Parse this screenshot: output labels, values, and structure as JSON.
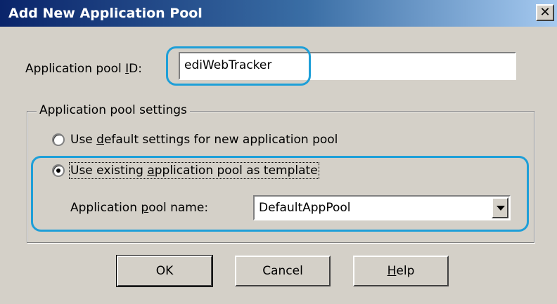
{
  "window": {
    "title": "Add New Application Pool",
    "close_glyph": "✕"
  },
  "pool_id": {
    "label_pre": "Application pool ",
    "label_key": "I",
    "label_post": "D:",
    "value": "ediWebTracker"
  },
  "settings": {
    "legend": "Application pool settings",
    "radio_default": {
      "label_pre": "Use ",
      "label_key": "d",
      "label_post": "efault settings for new application pool",
      "selected": false
    },
    "radio_existing": {
      "label_pre": "Use existing ",
      "label_key": "a",
      "label_post": "pplication pool as template",
      "selected": true
    },
    "pool_name": {
      "label_pre": "Application ",
      "label_key": "p",
      "label_post": "ool name:",
      "selected_value": "DefaultAppPool"
    }
  },
  "buttons": {
    "ok": "OK",
    "cancel": "Cancel",
    "help_key": "H",
    "help_post": "elp"
  },
  "colors": {
    "highlight": "#1e9fd8",
    "title_bar": "#0a246a",
    "dialog_bg": "#d4d0c8"
  }
}
